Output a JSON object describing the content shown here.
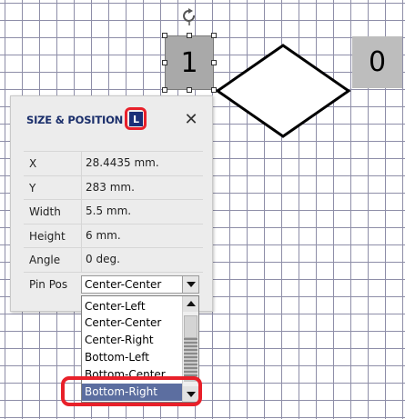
{
  "canvas": {
    "shape_selected_label": "1",
    "shape_other_label": "0"
  },
  "panel": {
    "title": "SIZE & POSITION",
    "lock_badge": "L",
    "close_symbol": "✕",
    "rows": [
      {
        "label": "X",
        "value": "28.4435 mm."
      },
      {
        "label": "Y",
        "value": "283 mm."
      },
      {
        "label": "Width",
        "value": "5.5 mm."
      },
      {
        "label": "Height",
        "value": "6 mm."
      },
      {
        "label": "Angle",
        "value": "0 deg."
      },
      {
        "label": "Pin Pos",
        "value": ""
      }
    ],
    "pin_pos_value": "Center-Center"
  },
  "dropdown": {
    "options": [
      "Center-Left",
      "Center-Center",
      "Center-Right",
      "Bottom-Left",
      "Bottom-Center",
      "Bottom-Right"
    ],
    "selected": "Bottom-Right"
  },
  "colors": {
    "accent_red": "#e8202a",
    "title_blue": "#1b2f6b",
    "selected_bg": "#5c6ea0"
  },
  "icons": {
    "rotate": "rotate-icon",
    "close": "close-icon",
    "dropdown": "chevron-down-icon"
  }
}
